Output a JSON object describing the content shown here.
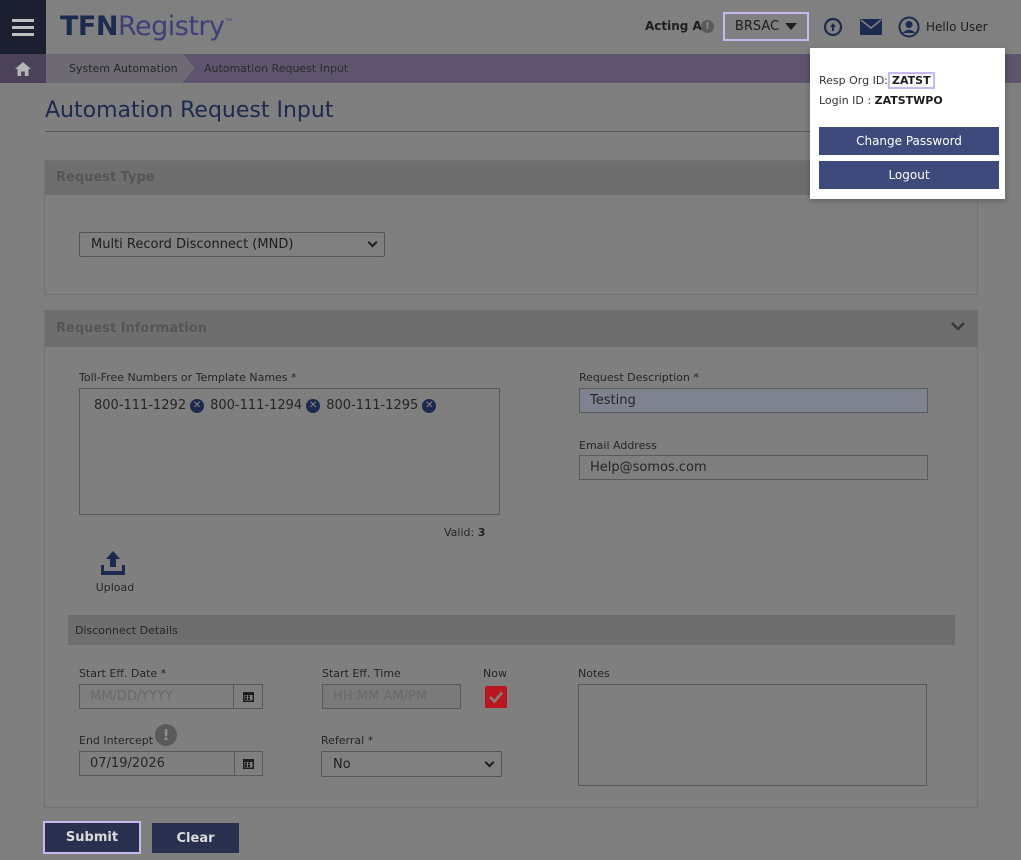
{
  "header": {
    "logo_tfn": "TFN",
    "logo_registry": "Registry",
    "logo_tm": "™",
    "acting_as_label": "Acting As",
    "acting_as_value": "BRSAC",
    "greeting": "Hello User"
  },
  "breadcrumb": {
    "items": [
      "System Automation",
      "Automation Request Input"
    ]
  },
  "page": {
    "title": "Automation Request Input"
  },
  "request_type": {
    "header": "Request Type",
    "selected": "Multi Record Disconnect (MND)"
  },
  "request_info": {
    "header": "Request Information",
    "tfn_label": "Toll-Free Numbers or Template Names *",
    "numbers": [
      "800-111-1292",
      "800-111-1294",
      "800-111-1295"
    ],
    "valid_label": "Valid:",
    "valid_count": "3",
    "upload_label": "Upload",
    "description_label": "Request Description *",
    "description_value": "Testing",
    "email_label": "Email Address",
    "email_value": "Help@somos.com",
    "disconnect_header": "Disconnect Details",
    "start_date_label": "Start Eff. Date *",
    "start_date_placeholder": "MM/DD/YYYY",
    "start_time_label": "Start Eff. Time",
    "start_time_placeholder": "HH:MM AM/PM",
    "now_label": "Now",
    "now_checked": true,
    "notes_label": "Notes",
    "end_intercept_label": "End Intercept",
    "end_intercept_value": "07/19/2026",
    "referral_label": "Referral *",
    "referral_value": "No"
  },
  "actions": {
    "submit": "Submit",
    "clear": "Clear"
  },
  "user_menu": {
    "resp_org_label": "Resp Org ID:",
    "resp_org_value": "ZATST",
    "login_label": "Login ID :",
    "login_value": "ZATSTWPO",
    "change_password": "Change Password",
    "logout": "Logout"
  },
  "colors": {
    "navy": "#1d2a50",
    "menu_button": "#3e4a7c",
    "highlight": "#c9b8f0",
    "checkbox": "#b8171f"
  }
}
